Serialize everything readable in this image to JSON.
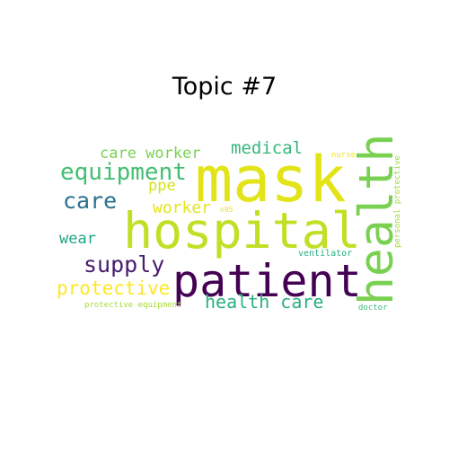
{
  "title": "Topic #7",
  "words": [
    {
      "text": "mask",
      "color": "#e2e418"
    },
    {
      "text": "hospital",
      "color": "#c0df25"
    },
    {
      "text": "patient",
      "color": "#440154"
    },
    {
      "text": "health",
      "color": "#7ad151"
    },
    {
      "text": "health care",
      "color": "#2ab07f"
    },
    {
      "text": "equipment",
      "color": "#42be71"
    },
    {
      "text": "supply",
      "color": "#481c6e"
    },
    {
      "text": "care",
      "color": "#2c728e"
    },
    {
      "text": "protective",
      "color": "#fde725"
    },
    {
      "text": "medical",
      "color": "#35b779"
    },
    {
      "text": "care worker",
      "color": "#7ad151"
    },
    {
      "text": "worker",
      "color": "#e5e419"
    },
    {
      "text": "wear",
      "color": "#21a685"
    },
    {
      "text": "ppe",
      "color": "#d5e21a"
    },
    {
      "text": "ventilator",
      "color": "#29af7f"
    },
    {
      "text": "personal protective",
      "color": "#a0da39"
    },
    {
      "text": "protective equipment",
      "color": "#a8db34"
    },
    {
      "text": "nurse",
      "color": "#f1e51d"
    },
    {
      "text": "doctor",
      "color": "#3aba76"
    },
    {
      "text": "n95",
      "color": "#e7e419"
    }
  ]
}
